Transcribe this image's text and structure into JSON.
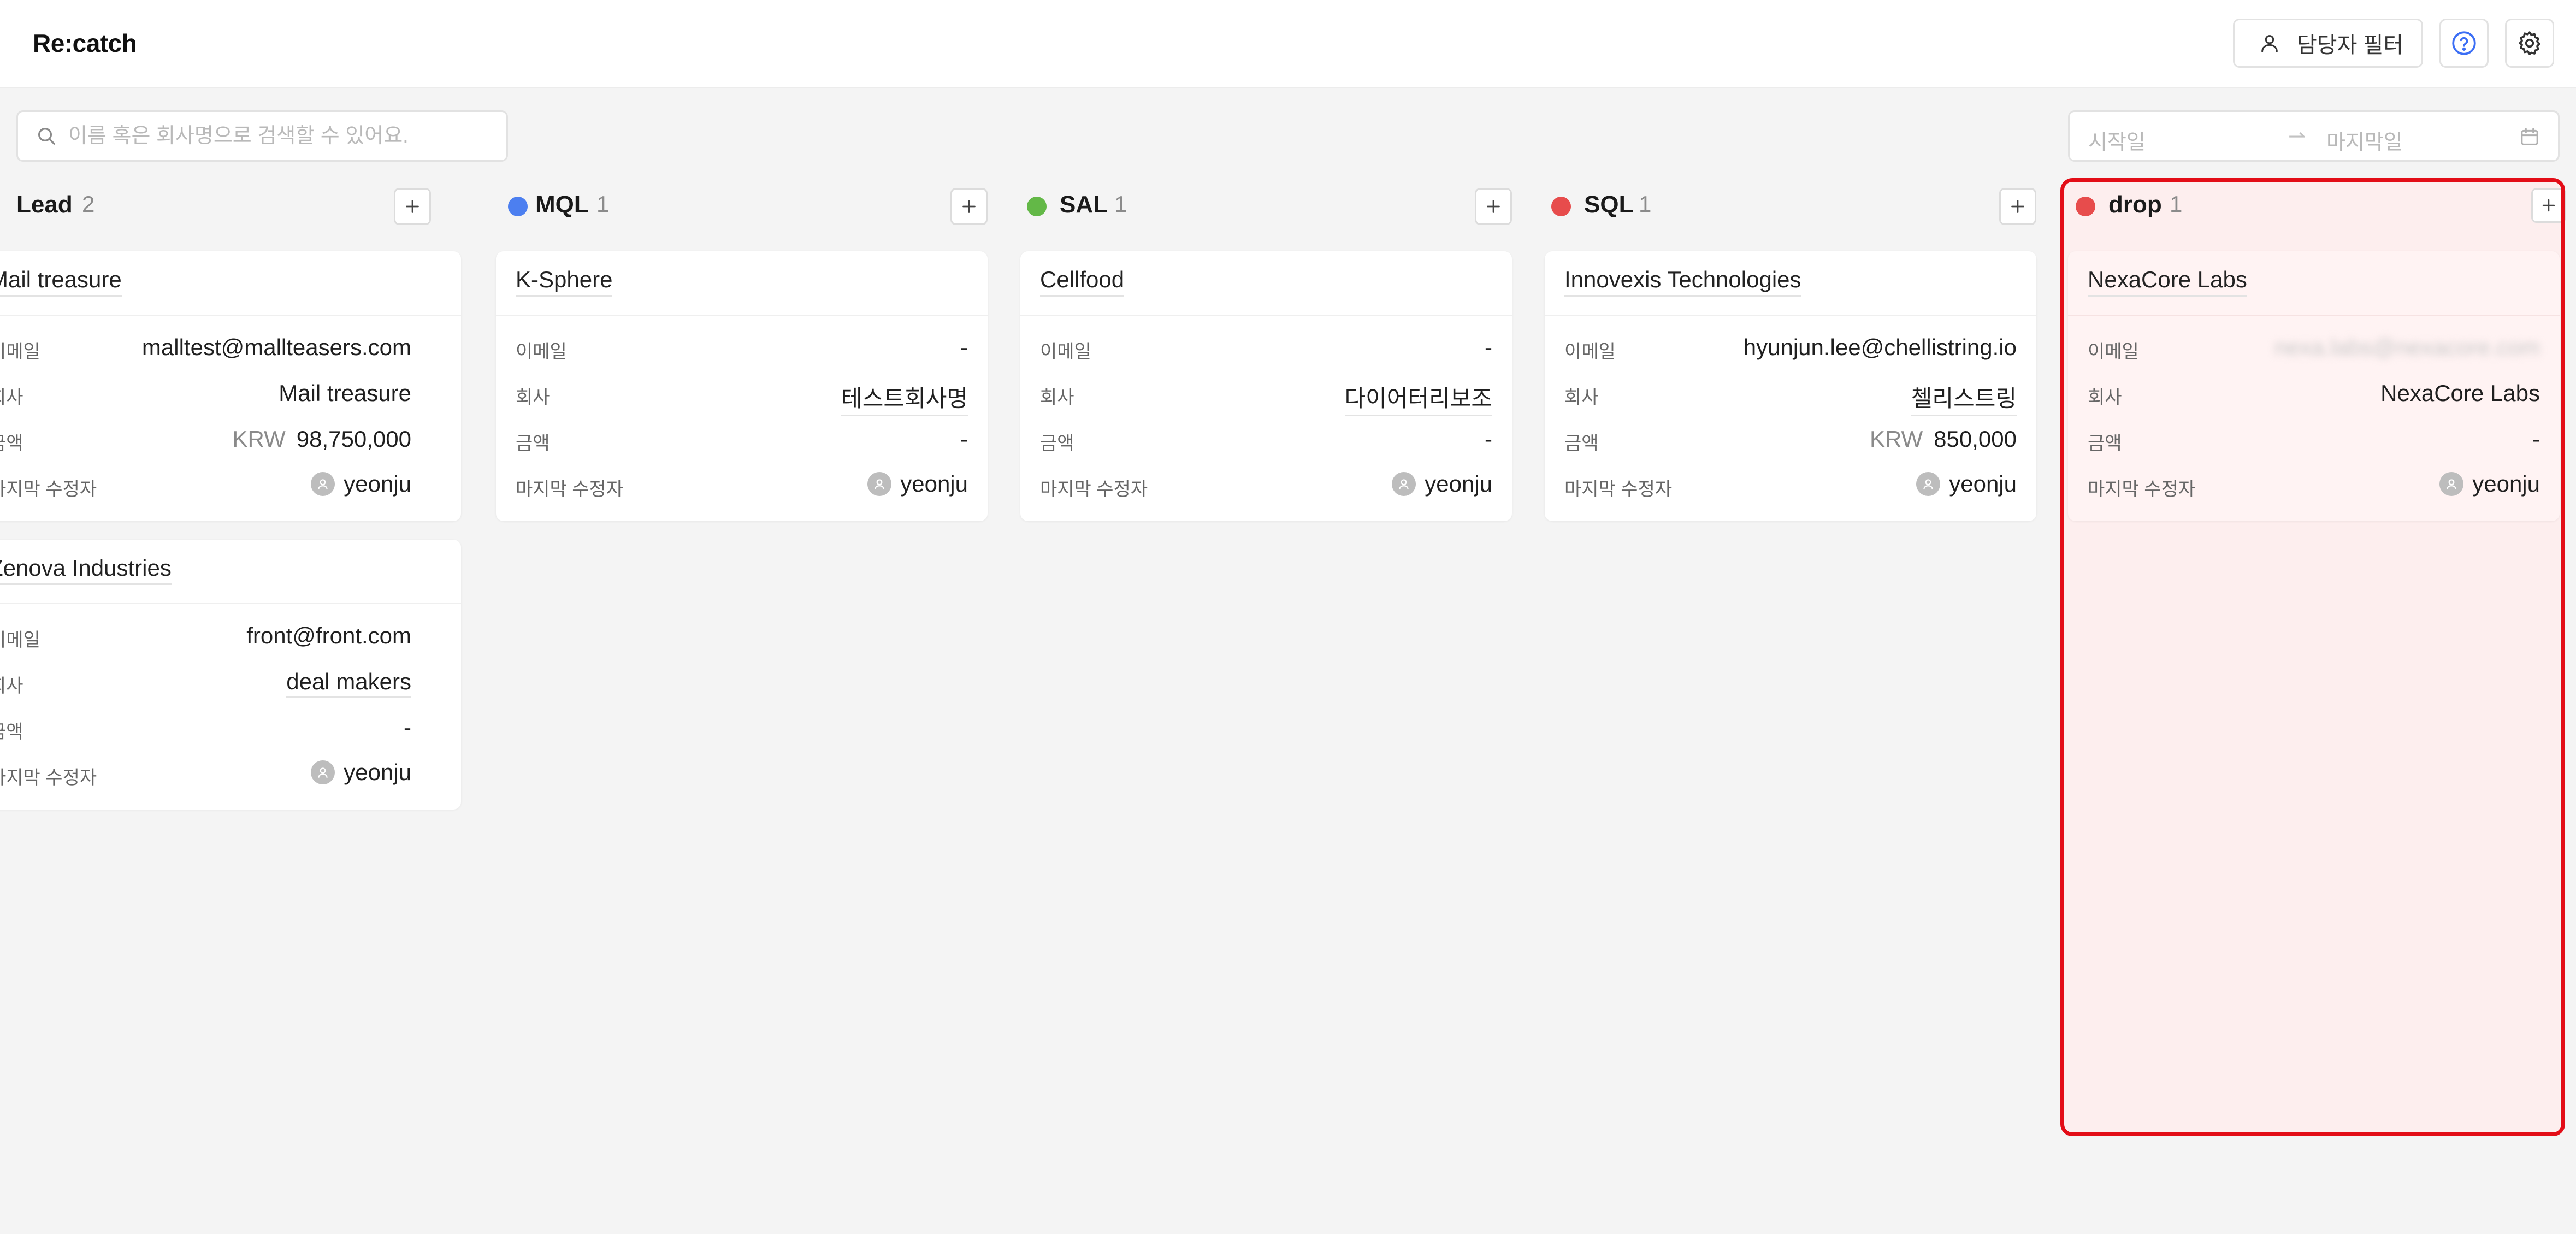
{
  "header": {
    "brand": "Re:catch",
    "owner_filter_label": "담당자 필터"
  },
  "toolbar": {
    "search_placeholder": "이름 혹은 회사명으로 검색할 수 있어요.",
    "search_value": "",
    "date_start_placeholder": "시작일",
    "date_arrow": "⇀",
    "date_end_placeholder": "마지막일"
  },
  "labels": {
    "email": "이메일",
    "company": "회사",
    "amount": "금액",
    "last_editor": "마지막 수정자"
  },
  "colors": {
    "lead": "",
    "mql": "#4c7ff0",
    "sal": "#63b847",
    "sql": "#e74c4c",
    "drop": "#e74c4c",
    "highlight_outline": "#e30d17"
  },
  "columns": [
    {
      "title": "Lead",
      "count": "2",
      "cards": [
        {
          "title": "Mail treasure",
          "email": "malltest@mallteasers.com",
          "company": "Mail treasure",
          "amount_currency": "KRW",
          "amount": "98,750,000",
          "editor": "yeonju"
        },
        {
          "title": "Zenova Industries",
          "email": "front@front.com",
          "company": "deal makers",
          "amount_currency": "",
          "amount": "-",
          "editor": "yeonju"
        }
      ]
    },
    {
      "title": "MQL",
      "count": "1",
      "cards": [
        {
          "title": "K-Sphere",
          "email": "-",
          "company": "테스트회사명",
          "amount_currency": "",
          "amount": "-",
          "editor": "yeonju"
        }
      ]
    },
    {
      "title": "SAL",
      "count": "1",
      "cards": [
        {
          "title": "Cellfood",
          "email": "-",
          "company": "다이어터리보조",
          "amount_currency": "",
          "amount": "-",
          "editor": "yeonju"
        }
      ]
    },
    {
      "title": "SQL",
      "count": "1",
      "cards": [
        {
          "title": "Innovexis Technologies",
          "email": "hyunjun.lee@chellistring.io",
          "company": "첼리스트링",
          "amount_currency": "KRW",
          "amount": "850,000",
          "editor": "yeonju"
        }
      ]
    },
    {
      "title": "drop",
      "count": "1",
      "cards": [
        {
          "title": "NexaCore Labs",
          "email": "nexa.labs@nexacore.com",
          "company": "NexaCore Labs",
          "amount_currency": "",
          "amount": "-",
          "editor": "yeonju"
        }
      ]
    }
  ]
}
